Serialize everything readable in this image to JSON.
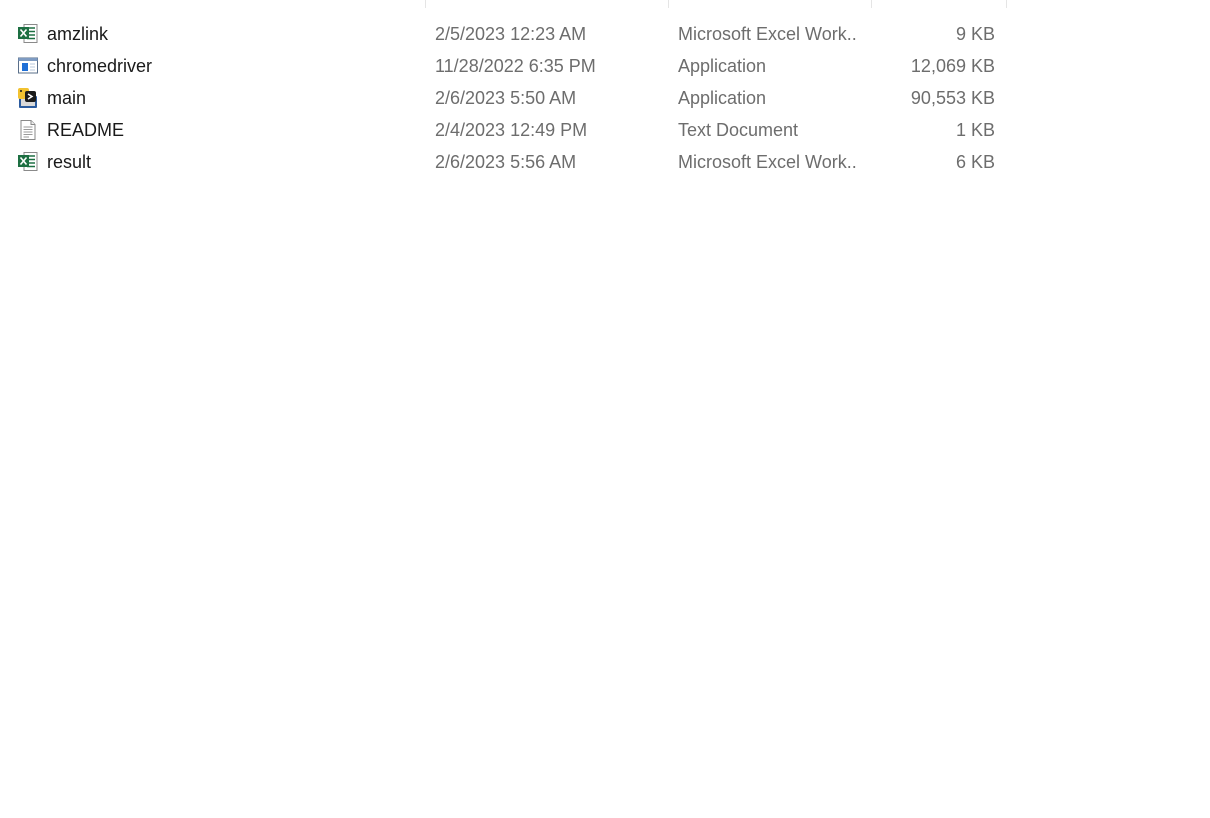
{
  "files": [
    {
      "name": "amzlink",
      "date_modified": "2/5/2023 12:23 AM",
      "type": "Microsoft Excel Work...",
      "size": "9 KB",
      "icon": "excel-file-icon"
    },
    {
      "name": "chromedriver",
      "date_modified": "11/28/2022 6:35 PM",
      "type": "Application",
      "size": "12,069 KB",
      "icon": "application-icon"
    },
    {
      "name": "main",
      "date_modified": "2/6/2023 5:50 AM",
      "type": "Application",
      "size": "90,553 KB",
      "icon": "python-application-icon"
    },
    {
      "name": "README",
      "date_modified": "2/4/2023 12:49 PM",
      "type": "Text Document",
      "size": "1 KB",
      "icon": "text-document-icon"
    },
    {
      "name": "result",
      "date_modified": "2/6/2023 5:56 AM",
      "type": "Microsoft Excel Work...",
      "size": "6 KB",
      "icon": "excel-file-icon"
    }
  ],
  "colors": {
    "excel_green": "#1d6f42",
    "app_blue": "#1f6fd6",
    "python_yellow": "#f2c230",
    "python_blue": "#2b5b9e"
  }
}
